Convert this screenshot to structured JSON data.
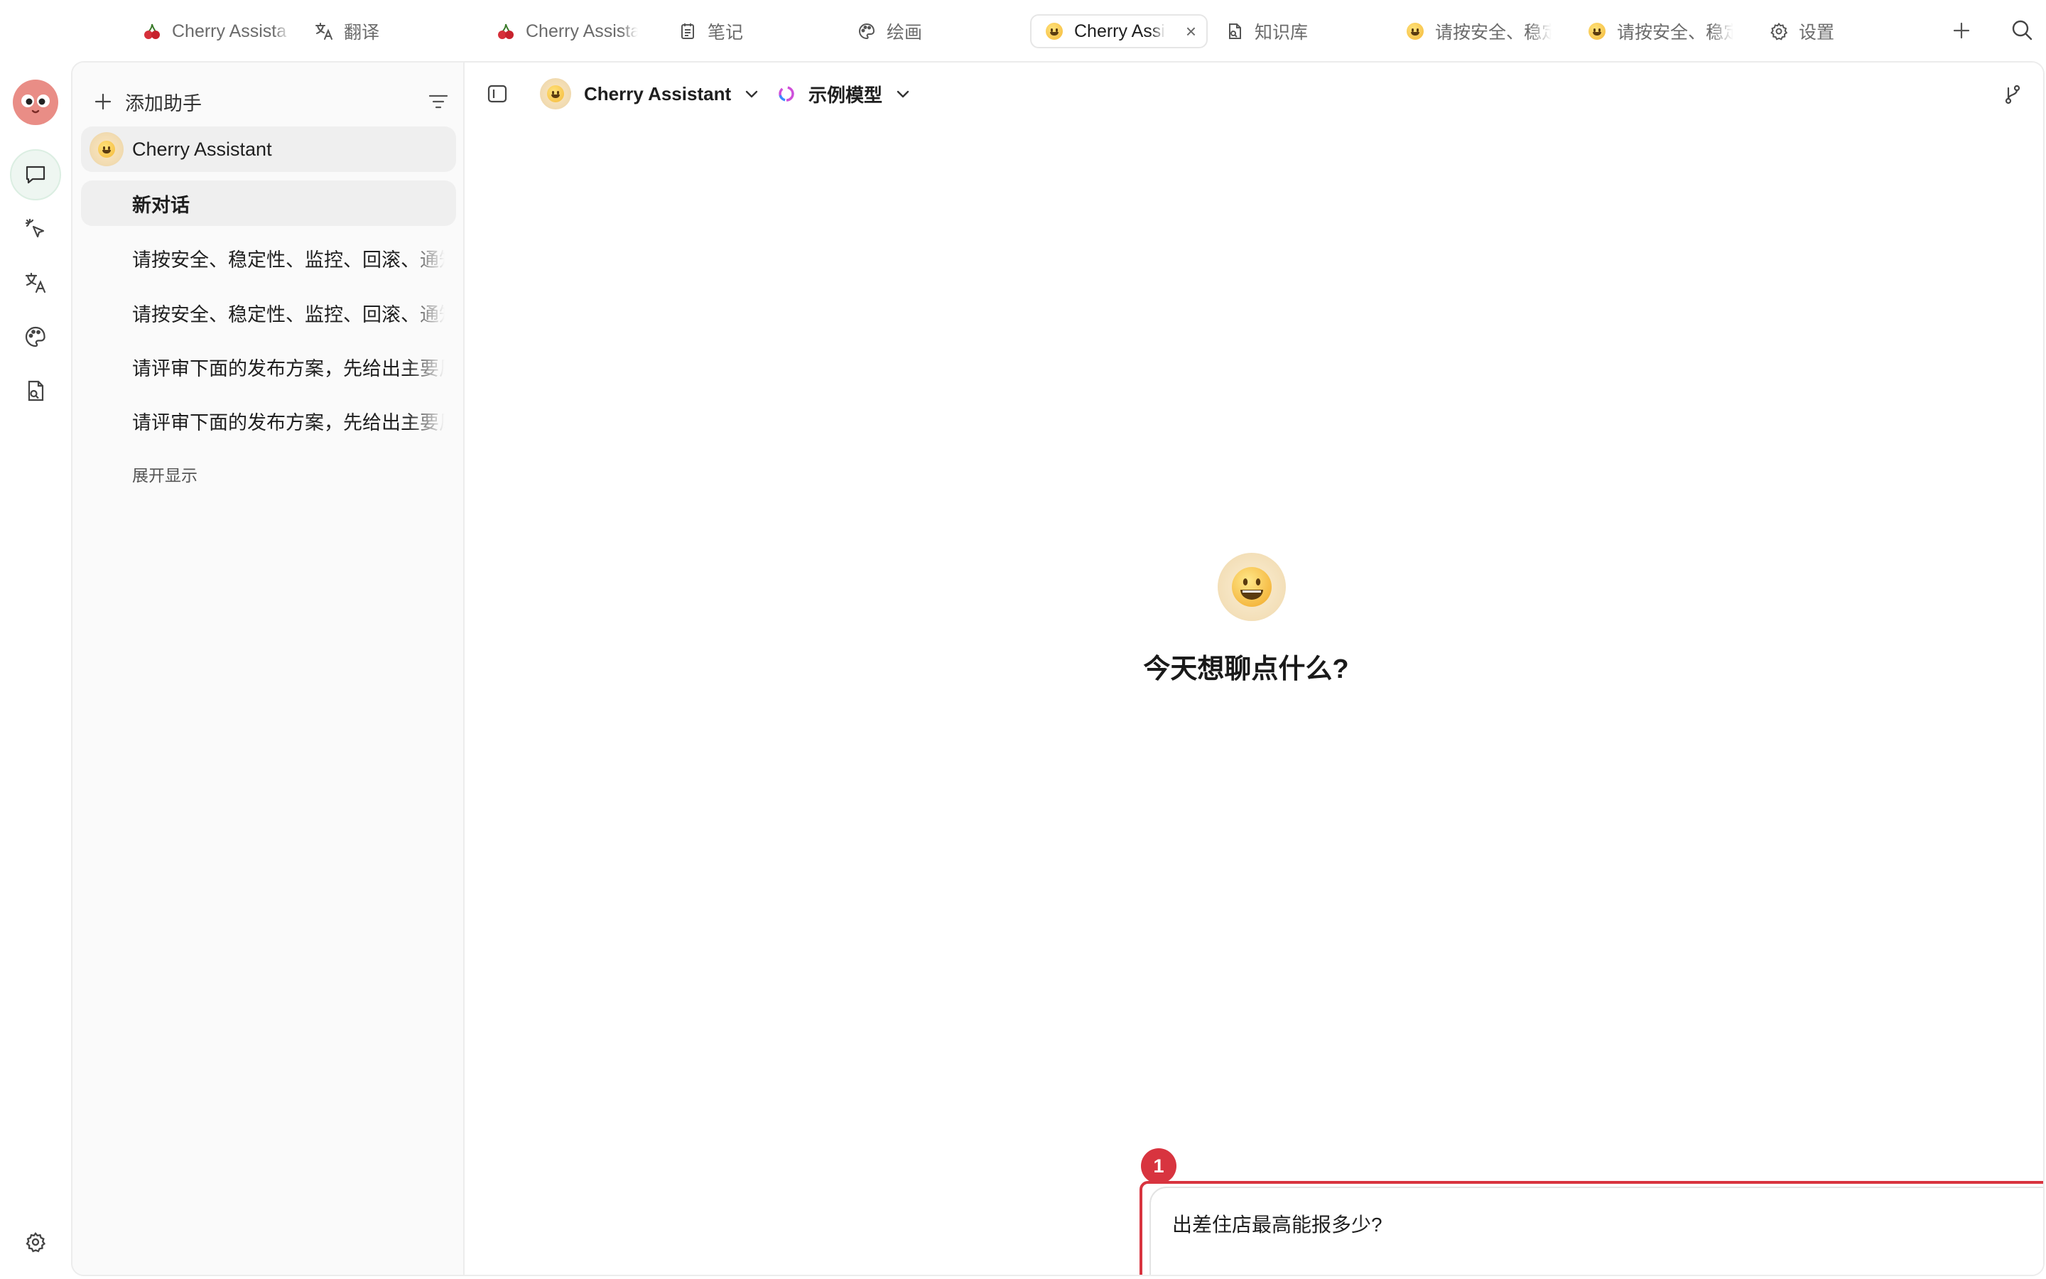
{
  "tabs": [
    {
      "label": "Cherry Assista",
      "icon": "cherry-icon"
    },
    {
      "label": "翻译",
      "icon": "translate-icon"
    },
    {
      "label": "Cherry Assista",
      "icon": "cherry-icon"
    },
    {
      "label": "笔记",
      "icon": "notes-icon"
    },
    {
      "label": "绘画",
      "icon": "palette-icon"
    },
    {
      "label": "Cherry Assi",
      "icon": "smile-emoji-icon",
      "active": true,
      "close": "×"
    },
    {
      "label": "知识库",
      "icon": "knowledge-icon"
    },
    {
      "label": "请按安全、稳定",
      "icon": "smile-emoji-icon"
    },
    {
      "label": "请按安全、稳定",
      "icon": "smile-emoji-icon"
    },
    {
      "label": "设置",
      "icon": "gear-icon"
    }
  ],
  "sidebar": {
    "add_label": "添加助手",
    "assistant": {
      "name": "Cherry Assistant",
      "icon": "smile-emoji-icon"
    },
    "topics": [
      {
        "label": "新对话",
        "selected": true
      },
      {
        "label": "请按安全、稳定性、监控、回滚、通知"
      },
      {
        "label": "请按安全、稳定性、监控、回滚、通知"
      },
      {
        "label": "请评审下面的发布方案，先给出主要风险"
      },
      {
        "label": "请评审下面的发布方案，先给出主要风险"
      }
    ],
    "expand_label": "展开显示"
  },
  "header": {
    "assistant_name": "Cherry Assistant",
    "model_name": "示例模型"
  },
  "welcome": {
    "title": "今天想聊点什么?"
  },
  "input": {
    "value": "出差住店最高能报多少?",
    "badge": "1"
  },
  "colors": {
    "accent_green": "#17a95a",
    "highlight_red": "#d8343f",
    "avatar_pink": "#e98d86"
  }
}
